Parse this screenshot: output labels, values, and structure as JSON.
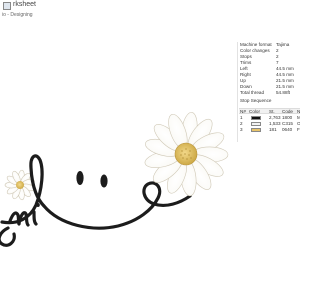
{
  "window": {
    "title": "rksheet",
    "subtitle": "io - Designing"
  },
  "properties": [
    {
      "label": "Machine format",
      "value": "Tajima"
    },
    {
      "label": "Color changes",
      "value": "2"
    },
    {
      "label": "Stops",
      "value": "2"
    },
    {
      "label": "Trims",
      "value": "7"
    },
    {
      "label": "Left",
      "value": "44.5 mm"
    },
    {
      "label": "Right",
      "value": "44.5 mm"
    },
    {
      "label": "Up",
      "value": "21.5 mm"
    },
    {
      "label": "Down",
      "value": "21.5 mm"
    },
    {
      "label": "Total thread",
      "value": "54.88ft"
    },
    {
      "label": "Stop Sequence",
      "value": ""
    }
  ],
  "stop_table": {
    "headers": [
      "N#",
      "Color",
      "St.",
      "Code",
      "N"
    ],
    "rows": [
      {
        "n": "1",
        "color": "#111111",
        "stitches": "2,763",
        "code": "1800",
        "c": "M"
      },
      {
        "n": "2",
        "color": "#f2f2f2",
        "stitches": "1,533",
        "code": "C315",
        "c": "O"
      },
      {
        "n": "3",
        "color": "#e8c46a",
        "stitches": "181",
        "code": "0640",
        "c": "F"
      }
    ]
  },
  "design": {
    "text": "mi",
    "thread_colors": {
      "outline": "#1c1c1c",
      "petal": "#ffffff",
      "petal_shadow": "#e4e0d6",
      "center": "#e3c35d"
    }
  }
}
